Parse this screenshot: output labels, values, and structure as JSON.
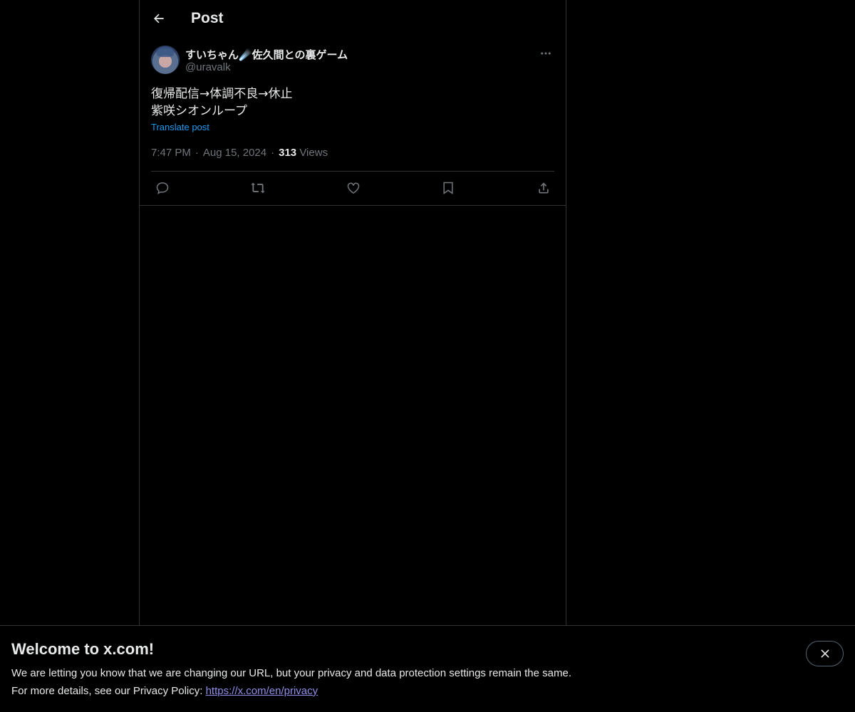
{
  "header": {
    "title": "Post",
    "back_icon": "arrow-left-icon"
  },
  "post": {
    "display_name": "すいちゃん☄️佐久間との裏ゲーム",
    "handle": "@uravalk",
    "text": "復帰配信→体調不良→休止\n紫咲シオンループ",
    "translate_label": "Translate post",
    "time": "7:47 PM",
    "date": "Aug 15, 2024",
    "views_count": "313",
    "views_label": "Views",
    "more_icon": "more-horizontal-icon",
    "actions": [
      {
        "name": "reply",
        "icon": "reply-icon"
      },
      {
        "name": "repost",
        "icon": "repost-icon"
      },
      {
        "name": "like",
        "icon": "heart-icon"
      },
      {
        "name": "bookmark",
        "icon": "bookmark-icon"
      },
      {
        "name": "share",
        "icon": "share-icon"
      }
    ]
  },
  "banner": {
    "title": "Welcome to x.com!",
    "line1": "We are letting you know that we are changing our URL, but your privacy and data protection settings remain the same.",
    "line2_prefix": "For more details, see our Privacy Policy: ",
    "privacy_link": "https://x.com/en/privacy",
    "close_icon": "close-icon"
  },
  "colors": {
    "background": "#000000",
    "text": "#e7e9ea",
    "muted": "#71767b",
    "accent": "#1d9bf0",
    "border": "#2f3336"
  }
}
